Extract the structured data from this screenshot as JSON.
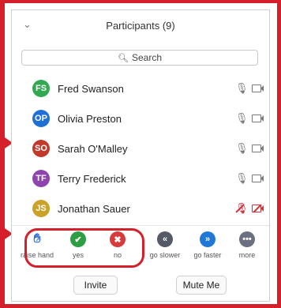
{
  "header": {
    "title": "Participants (9)",
    "collapse_icon": "chevron-down-icon"
  },
  "search": {
    "placeholder": "Search"
  },
  "participants": [
    {
      "initials": "FS",
      "name": "Fred Swanson",
      "color": "#33a852",
      "muted": false
    },
    {
      "initials": "OP",
      "name": "Olivia Preston",
      "color": "#1f6fd6",
      "muted": false
    },
    {
      "initials": "SO",
      "name": "Sarah O'Malley",
      "color": "#c0392b",
      "muted": false
    },
    {
      "initials": "TF",
      "name": "Terry Frederick",
      "color": "#8e44ad",
      "muted": false
    },
    {
      "initials": "JS",
      "name": "Jonathan Sauer",
      "color": "#c9a227",
      "muted": true
    }
  ],
  "reactions": [
    {
      "label": "raise hand",
      "icon": "raised-hand-icon",
      "color": "#2e6fd8"
    },
    {
      "label": "yes",
      "icon": "checkmark-icon",
      "color": "#2e9e44"
    },
    {
      "label": "no",
      "icon": "x-icon",
      "color": "#d63a3a"
    },
    {
      "label": "go slower",
      "icon": "rewind-icon",
      "color": "#555a66"
    },
    {
      "label": "go faster",
      "icon": "fast-forward-icon",
      "color": "#1f78d6"
    },
    {
      "label": "more",
      "icon": "more-dots-icon",
      "color": "#6b7080"
    }
  ],
  "footer": {
    "invite_label": "Invite",
    "mute_me_label": "Mute Me"
  },
  "colors": {
    "annotation": "#d51f2b"
  }
}
